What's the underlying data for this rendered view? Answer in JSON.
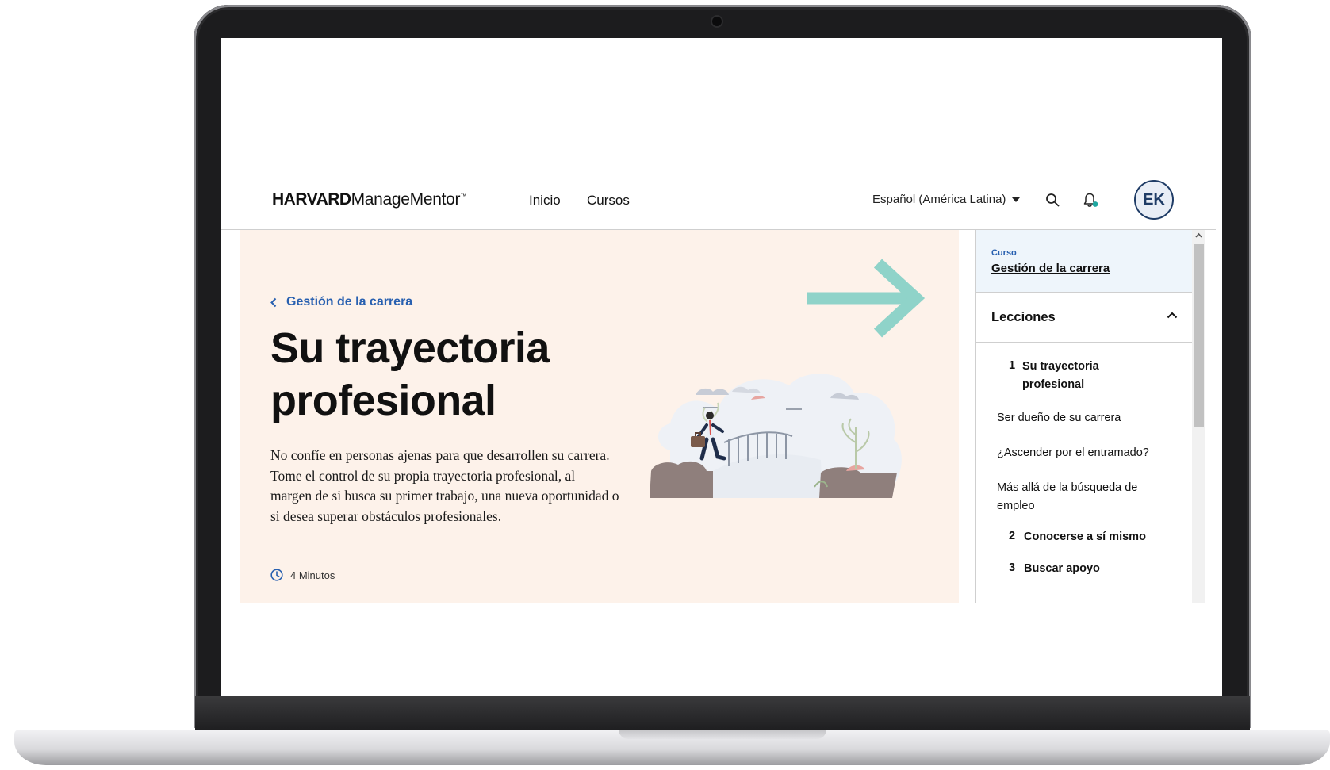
{
  "header": {
    "logo_bold": "HARVARD",
    "logo_light": "ManageMentor",
    "nav": {
      "home": "Inicio",
      "courses": "Cursos"
    },
    "language": "Español (América Latina)",
    "avatar_initials": "EK"
  },
  "hero": {
    "back_link": "Gestión de la carrera",
    "title": "Su trayectoria profesional",
    "description": "No confíe en personas ajenas para que desarrollen su carrera. Tome el control de su propia trayectoria profesional, al margen de si busca su primer trabajo, una nueva oportunidad o si desea superar obstáculos profesionales.",
    "duration": "4 Minutos"
  },
  "sidebar": {
    "course_label": "Curso",
    "course_name": "Gestión de la carrera",
    "lessons_title": "Lecciones",
    "lessons": [
      {
        "number": "1",
        "title": "Su trayectoria profesional"
      },
      {
        "number": "",
        "title": "Ser dueño de su carrera"
      },
      {
        "number": "",
        "title": "¿Ascender por el entramado?"
      },
      {
        "number": "",
        "title": "Más allá de la búsqueda de empleo"
      },
      {
        "number": "2",
        "title": "Conocerse a sí mismo"
      },
      {
        "number": "3",
        "title": "Buscar apoyo"
      }
    ]
  },
  "colors": {
    "accent_blue": "#2860b0",
    "hero_bg": "#fdf2ea",
    "arrow_teal": "#8fd3c9",
    "navy": "#1f3c66"
  },
  "icons": [
    "chevron-left-icon",
    "clock-icon",
    "search-icon",
    "bell-icon",
    "chevron-up-icon",
    "caret-down-icon"
  ]
}
